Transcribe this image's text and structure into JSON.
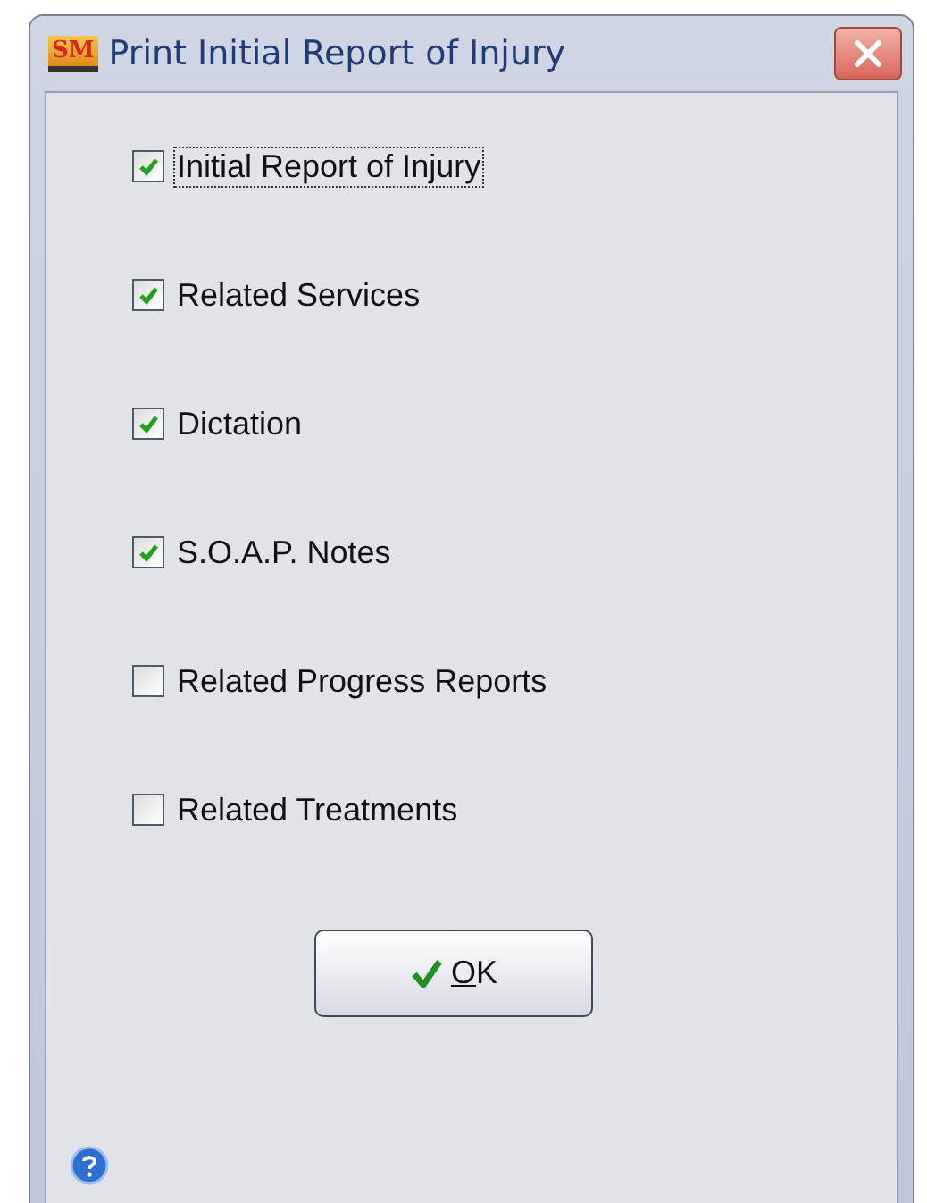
{
  "window": {
    "title": "Print Initial Report of Injury",
    "logo": "SM"
  },
  "options": [
    {
      "label": "Initial Report of Injury",
      "checked": true,
      "focused": true
    },
    {
      "label": "Related Services",
      "checked": true,
      "focused": false
    },
    {
      "label": "Dictation",
      "checked": true,
      "focused": false
    },
    {
      "label": "S.O.A.P. Notes",
      "checked": true,
      "focused": false
    },
    {
      "label": "Related Progress Reports",
      "checked": false,
      "focused": false
    },
    {
      "label": "Related Treatments",
      "checked": false,
      "focused": false
    }
  ],
  "buttons": [
    {
      "label": "OK"
    }
  ]
}
